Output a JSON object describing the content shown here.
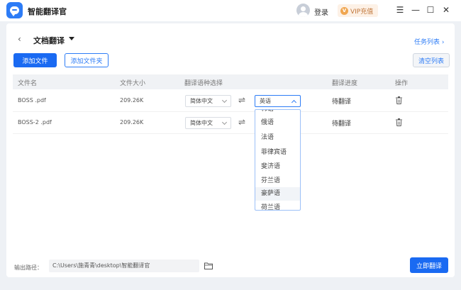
{
  "app": {
    "title": "智能翻译官",
    "login": "登录",
    "vip": "VIP充值",
    "vip_badge": "V"
  },
  "window": {
    "menu": "☰",
    "minimize": "—",
    "maximize": "☐",
    "close": "✕"
  },
  "header": {
    "back": "‹",
    "title": "文档翻译",
    "task_list": "任务列表 ›"
  },
  "toolbar": {
    "add_file": "添加文件",
    "add_folder": "添加文件夹",
    "clear_list": "清空列表"
  },
  "table": {
    "columns": [
      "文件名",
      "文件大小",
      "翻译语种选择",
      "翻译进度",
      "操作"
    ],
    "rows": [
      {
        "name": "BOSS .pdf",
        "size": "209.26K",
        "source": "简体中文",
        "target": "英语",
        "status": "待翻译"
      },
      {
        "name": "BOSS-2 .pdf",
        "size": "209.26K",
        "source": "简体中文",
        "target": "",
        "status": "待翻译"
      }
    ]
  },
  "dropdown": {
    "options": [
      "韩语",
      "俄语",
      "法语",
      "菲律宾语",
      "斐济语",
      "芬兰语",
      "豪萨语",
      "荷兰语"
    ],
    "hovered_index": 6
  },
  "footer": {
    "output_label": "输出路径：",
    "output_path": "C:\\Users\\施青青\\desktop\\智能翻译官",
    "translate_button": "立即翻译"
  },
  "icons": {
    "swap": "⇌",
    "trash": "trash-icon",
    "folder": "folder-icon"
  },
  "colors": {
    "accent": "#1a6af2",
    "link": "#2d7cf6",
    "vip": "#f0a650"
  }
}
